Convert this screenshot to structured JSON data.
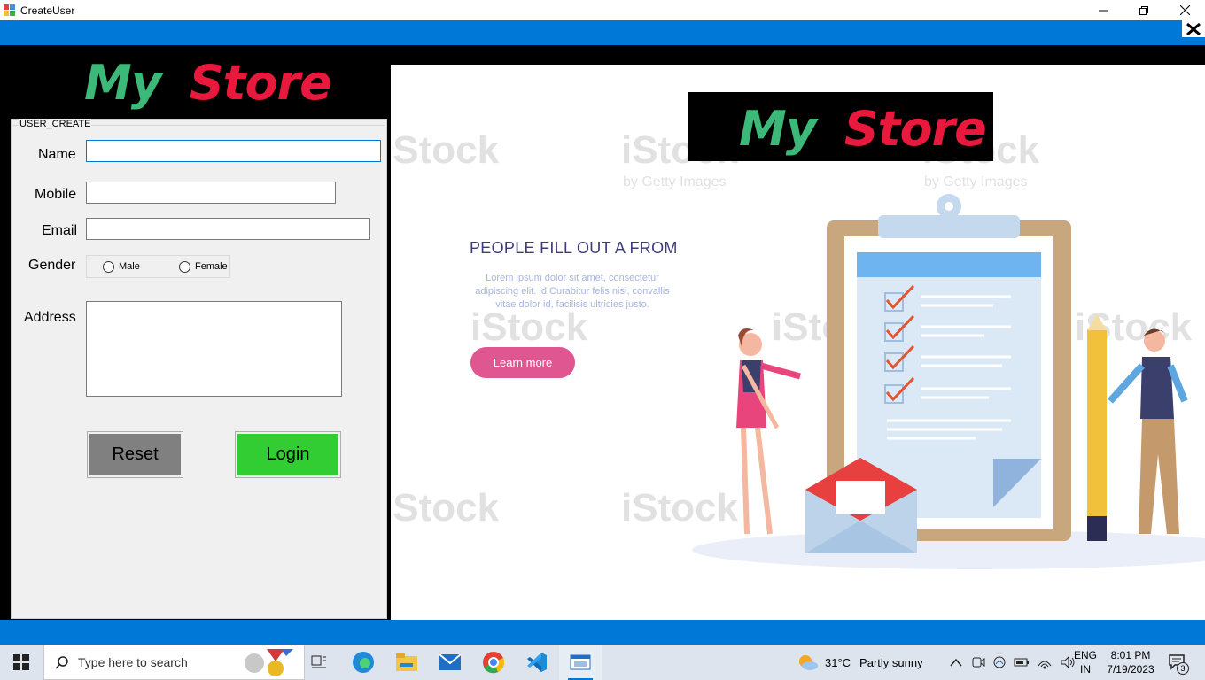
{
  "window": {
    "title": "CreateUser",
    "close_glyph": "✕"
  },
  "brand": {
    "word1": "My",
    "word2": "Store",
    "green": "#3cb878",
    "red": "#e8193c"
  },
  "form": {
    "group_label": "USER_CREATE",
    "name_label": "Name",
    "name_value": "",
    "mobile_label": "Mobile",
    "mobile_value": "",
    "email_label": "Email",
    "email_value": "",
    "gender_label": "Gender",
    "gender_options": [
      "Male",
      "Female"
    ],
    "address_label": "Address",
    "address_value": "",
    "reset_label": "Reset",
    "login_label": "Login",
    "reset_color": "#808080",
    "login_color": "#32cd32"
  },
  "illustration": {
    "headline": "PEOPLE FILL OUT A FROM",
    "lorem": "Lorem ipsum dolor sit amet, consectetur adipiscing elit. id Curabitur felis nisi, convallis vitae dolor id, facilisis ultricies justo.",
    "button": "Learn more",
    "watermark": "iStock",
    "watermark_sub": "by Getty Images"
  },
  "taskbar": {
    "search_placeholder": "Type here to search",
    "weather_temp": "31°C",
    "weather_text": "Partly sunny",
    "lang_line1": "ENG",
    "lang_line2": "IN",
    "time": "8:01 PM",
    "date": "7/19/2023",
    "notification_count": "3"
  }
}
